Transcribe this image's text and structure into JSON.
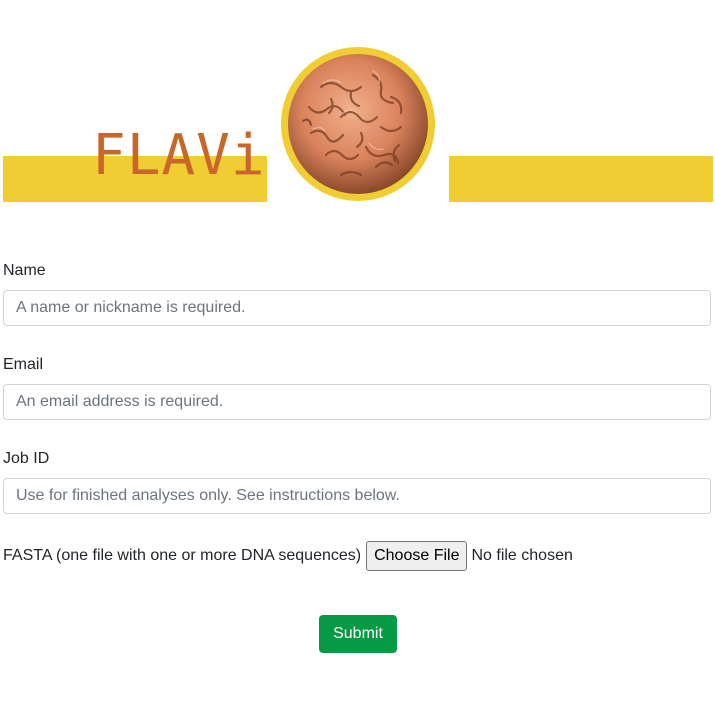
{
  "header": {
    "logo_text": "FLAVi",
    "logo_image_icon": "virus-particle-icon",
    "colors": {
      "banner": "#f0cd33",
      "logo_text": "#c9662a",
      "virus": "#e0916b"
    }
  },
  "form": {
    "name": {
      "label": "Name",
      "placeholder": "A name or nickname is required."
    },
    "email": {
      "label": "Email",
      "placeholder": "An email address is required."
    },
    "job_id": {
      "label": "Job ID",
      "placeholder": "Use for finished analyses only. See instructions below."
    },
    "fasta": {
      "label": "FASTA (one file with one or more DNA sequences)",
      "button_label": "Choose File",
      "status": "No file chosen"
    },
    "submit_label": "Submit",
    "colors": {
      "submit": "#079a45"
    }
  }
}
